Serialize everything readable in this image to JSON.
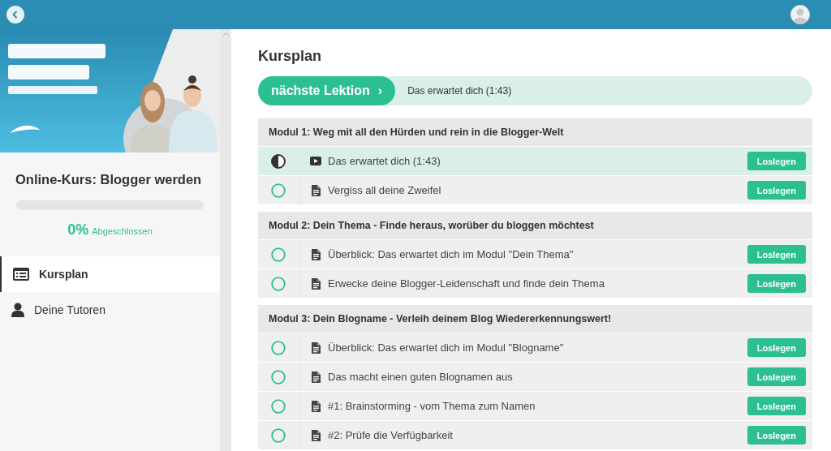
{
  "sidebar": {
    "course_title": "Online-Kurs: Blogger werden",
    "progress": {
      "level": 0,
      "percent": "0%",
      "label": "Abgeschlossen"
    },
    "nav": [
      {
        "label": "Kursplan",
        "kind": "plan",
        "selected": true
      },
      {
        "label": "Deine Tutoren",
        "kind": "tutors",
        "selected": false
      }
    ]
  },
  "main": {
    "title": "Kursplan",
    "next_lesson": {
      "button": "nächste Lektion",
      "arrow": "›",
      "lesson": "Das erwartet dich (1:43)"
    },
    "modules": [
      {
        "title": "Modul 1: Weg mit all den Hürden und rein in die Blogger-Welt",
        "lessons": [
          {
            "title": "Das erwartet dich (1:43)",
            "kind": "video",
            "started": true,
            "selected": true,
            "button": "Loslegen"
          },
          {
            "title": "Vergiss all deine Zweifel",
            "kind": "document",
            "started": false,
            "selected": false,
            "button": "Loslegen"
          }
        ]
      },
      {
        "title": "Modul 2: Dein Thema - Finde heraus, worüber du bloggen möchtest",
        "lessons": [
          {
            "title": "Überblick: Das erwartet dich im Modul \"Dein Thema\"",
            "kind": "document",
            "started": false,
            "selected": false,
            "button": "Loslegen"
          },
          {
            "title": "Erwecke deine Blogger-Leidenschaft und finde dein Thema",
            "kind": "document",
            "started": false,
            "selected": false,
            "button": "Loslegen"
          }
        ]
      },
      {
        "title": "Modul 3: Dein Blogname - Verleih deinem Blog Wiedererkennungswert!",
        "lessons": [
          {
            "title": "Überblick: Das erwartet dich im Modul \"Blogname\"",
            "kind": "document",
            "started": false,
            "selected": false,
            "button": "Loslegen"
          },
          {
            "title": "Das macht einen guten Blognamen aus",
            "kind": "document",
            "started": false,
            "selected": false,
            "button": "Loslegen"
          },
          {
            "title": "#1: Brainstorming - vom Thema zum Namen",
            "kind": "document",
            "started": false,
            "selected": false,
            "button": "Loslegen"
          },
          {
            "title": "#2: Prüfe die Verfügbarkeit",
            "kind": "document",
            "started": false,
            "selected": false,
            "button": "Loslegen"
          }
        ]
      }
    ]
  }
}
